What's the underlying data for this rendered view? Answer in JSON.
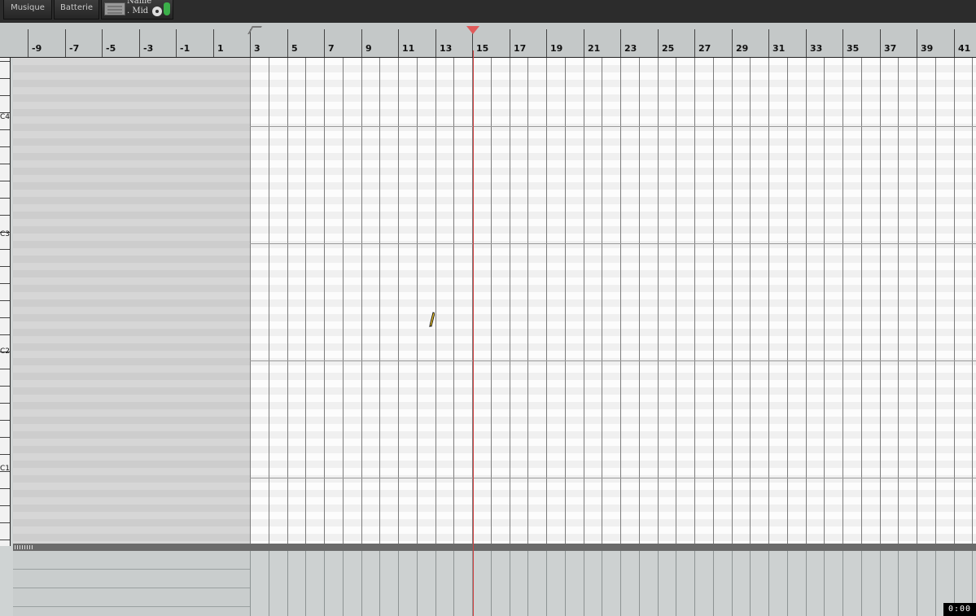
{
  "toolbar": {
    "musique_label": "Musique",
    "batterie_label": "Batterie",
    "file_name": "Name",
    "file_ext": ". Mid"
  },
  "ruler": {
    "labels": [
      "-9",
      "-7",
      "-5",
      "-3",
      "-1",
      "1",
      "3",
      "5",
      "7",
      "9",
      "11",
      "13",
      "15",
      "17",
      "19",
      "21",
      "23",
      "25",
      "27",
      "29",
      "31",
      "33",
      "35",
      "37",
      "39",
      "41"
    ]
  },
  "keyboard": {
    "labels": [
      "C4",
      "C3",
      "C2",
      "C1"
    ]
  },
  "playhead": {
    "position_measure": 15
  },
  "time_display": "0:00",
  "colors": {
    "playhead": "#d04040",
    "toolbar_bg": "#2c2c2c"
  }
}
